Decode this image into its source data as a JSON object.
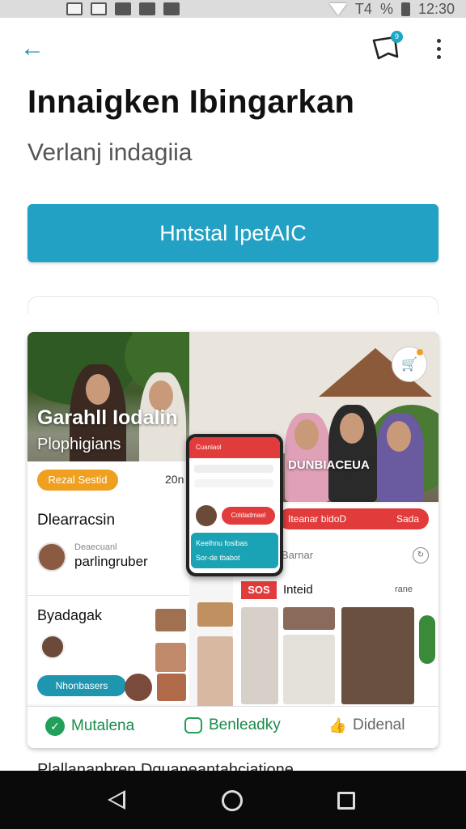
{
  "status_bar": {
    "battery_text": "T4",
    "percent_sign": "%",
    "time": "12:30"
  },
  "app_bar": {
    "notification_badge": "9"
  },
  "page": {
    "title": "Innaigken Ibingarkan",
    "subtitle": "Verlanj indagiia",
    "install_button": "Hntstal IpetAIC"
  },
  "collage": {
    "hero_title": "Garahll Iodalin",
    "hero_sub": "Plophigians",
    "hero_right_label": "DUNBIACEUA",
    "orange_pill": "Rezal Sestid",
    "pill_side": "20n",
    "left_heading": "Dlearracsin",
    "left_small": "Deaecuanl",
    "left_name": "parlingruber",
    "left_heading2": "Byadagak",
    "teal_pill": "Nhonbasers",
    "phone_header": "Cuaniaol",
    "phone_pill": "Coldadmael",
    "phone_teal_1": "Keelhnu fosibas",
    "phone_teal_2": "Sor-de tbabot",
    "right_red_bar": "Iteanar bidoD",
    "right_red_bar_end": "Sada",
    "right_small": "Barnar",
    "right_badge": "SOS",
    "right_label": "Inteid",
    "right_edit": "rane"
  },
  "actions": {
    "primary": "Mutalena",
    "secondary": "Benleadky",
    "tertiary": "Didenal"
  },
  "peek": {
    "text": "Plallananbren   Dquaneantahciatione"
  }
}
